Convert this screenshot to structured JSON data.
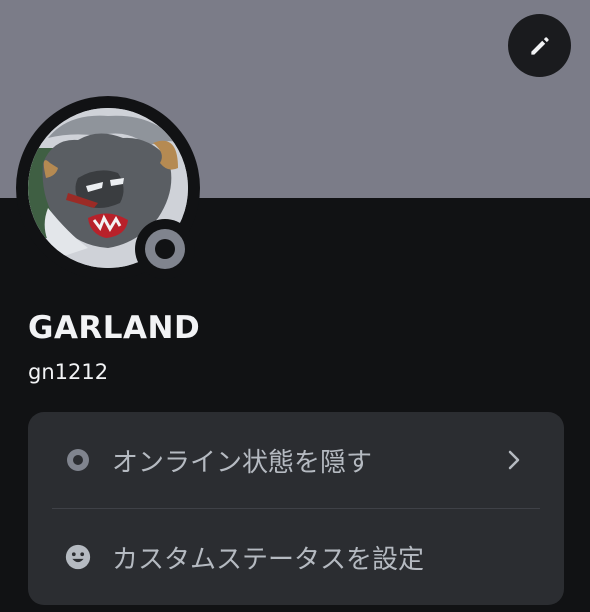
{
  "profile": {
    "display_name": "GARLAND",
    "username": "gn1212",
    "status": "invisible"
  },
  "banner": {
    "color": "#7b7c88"
  },
  "icons": {
    "edit": "pencil-icon",
    "status_indicator": "invisible-status-icon",
    "hide_online": "invisible-status-icon",
    "custom_status": "smiley-face-icon",
    "chevron": "chevron-right-icon"
  },
  "menu": {
    "items": [
      {
        "label": "オンライン状態を隠す",
        "icon": "invisible-status-icon",
        "has_chevron": true
      },
      {
        "label": "カスタムステータスを設定",
        "icon": "smiley-face-icon",
        "has_chevron": false
      }
    ]
  },
  "colors": {
    "background": "#111214",
    "card": "#2b2d31",
    "text_primary": "#f2f3f5",
    "text_secondary": "#b5bac1",
    "status_gray": "#80848e"
  }
}
